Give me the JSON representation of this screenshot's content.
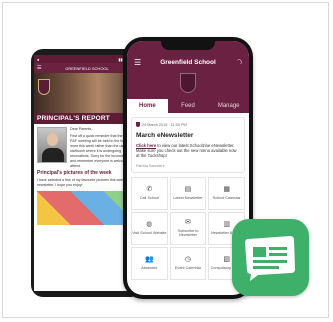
{
  "back_phone": {
    "school_name": "GREENFIELD SCHOOL",
    "menu_icon": "menu-icon",
    "section_title": "PRINCIPAL'S REPORT",
    "greeting": "Dear Parents,",
    "body_text": "First off a quick reminder that the weekly P&F meeting will be held in the hour 3 more this week rather than the usual staffroom where it is undergoing renovations. Sorry for the inconvenience and remember everyone is welcome to attend.",
    "subheading": "Principal's pictures of the week",
    "subtext": "I have selected a few of my favourite pictures this week's newsletter, I hope you enjoy!"
  },
  "front_phone": {
    "title": "Greenfield School",
    "menu_icon": "menu-icon",
    "rss_icon": "rss-icon",
    "tabs": [
      {
        "label": "Home",
        "active": true
      },
      {
        "label": "Feed",
        "active": false
      },
      {
        "label": "Manage",
        "active": false
      }
    ],
    "post": {
      "meta": "24 March 2019 · 11:00 PM",
      "title": "March eNewsletter",
      "link_text": "Click here",
      "body": " to view our latest Schoolzine eNewsletter. Make sure you check out the new menu available now at the Tuckshop!",
      "author": "Patricia Saunders"
    },
    "tiles": [
      {
        "icon": "phone-icon",
        "glyph": "✆",
        "label": "Call School"
      },
      {
        "icon": "newsletter-icon",
        "glyph": "▤",
        "label": "Latest Newsletter"
      },
      {
        "icon": "calendar-icon",
        "glyph": "▦",
        "label": "School Calendar"
      },
      {
        "icon": "globe-icon",
        "glyph": "◍",
        "label": "Visit School Website"
      },
      {
        "icon": "subscribe-icon",
        "glyph": "✉",
        "label": "Subscribe to Newsletter"
      },
      {
        "icon": "archive-icon",
        "glyph": "▥",
        "label": "Newsletter Archive"
      },
      {
        "icon": "absences-icon",
        "glyph": "👥",
        "label": "Absentee"
      },
      {
        "icon": "clock-icon",
        "glyph": "◷",
        "label": "Event Calendar"
      },
      {
        "icon": "forms-icon",
        "glyph": "▧",
        "label": "Compulsory Forms"
      }
    ]
  },
  "colors": {
    "brand": "#6b2242",
    "brand_dark": "#5e1d34",
    "app_icon": "#3fb06a"
  },
  "app_icon": {
    "icon": "newsletter-app-icon"
  }
}
